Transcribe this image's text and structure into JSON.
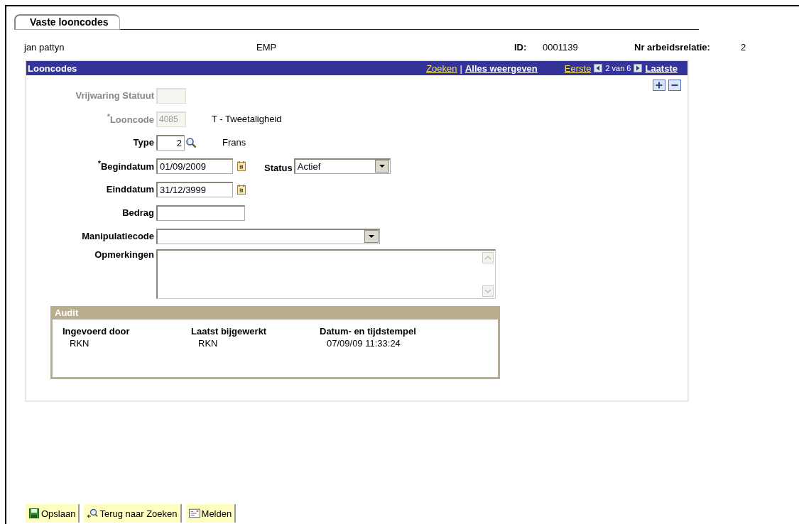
{
  "tab": {
    "label": "Vaste looncodes",
    "selected": true
  },
  "header": {
    "name": "jan pattyn",
    "type": "EMP",
    "id_label": "ID:",
    "id_value": "0001139",
    "relation_label": "Nr arbeidsrelatie:",
    "relation_value": "2"
  },
  "panel": {
    "title": "Looncodes",
    "search_link": "Zoeken",
    "separator": "|",
    "show_all_link": "Alles weergeven",
    "first_link": "Eerste",
    "position": "2 van 6",
    "last_link": "Laatste"
  },
  "fields": [
    {
      "kind": "code",
      "label": "Vrijwaring Statuut",
      "disabled": true
    },
    {
      "kind": "code",
      "label": "$^{*}$Looncode",
      "disabled": true,
      "value": "4085",
      "description": "T - Tweetaligheid"
    },
    {
      "kind": "lookup",
      "label": "Type",
      "disabled": false,
      "value": "2",
      "description": "Frans"
    },
    {
      "kind": "date",
      "label": "$^{*}$Begindatum",
      "disabled": false,
      "value": "01/09/2009",
      "side_label": "Status",
      "side_value": "Actief"
    },
    {
      "kind": "date",
      "label": "Einddatum",
      "disabled": false,
      "value": "31/12/3999"
    },
    {
      "kind": "amount",
      "label": "Bedrag",
      "disabled": false
    },
    {
      "kind": "select",
      "label": "Manipulatiecode",
      "disabled": false
    },
    {
      "kind": "textarea",
      "label": "Opmerkingen",
      "disabled": false
    }
  ],
  "audit": {
    "title": "Audit",
    "columns": [
      {
        "heading": "Ingevoerd door",
        "value": "RKN"
      },
      {
        "heading": "Laatst bijgewerkt",
        "value": "RKN"
      },
      {
        "heading": "Datum- en tijdstempel",
        "value": "07/09/09 11:33:24"
      }
    ]
  },
  "buttons": [
    {
      "kind": "save",
      "label": "Opslaan"
    },
    {
      "kind": "search",
      "label": "Terug naar Zoeken"
    },
    {
      "kind": "notify",
      "label": "Melden"
    }
  ]
}
